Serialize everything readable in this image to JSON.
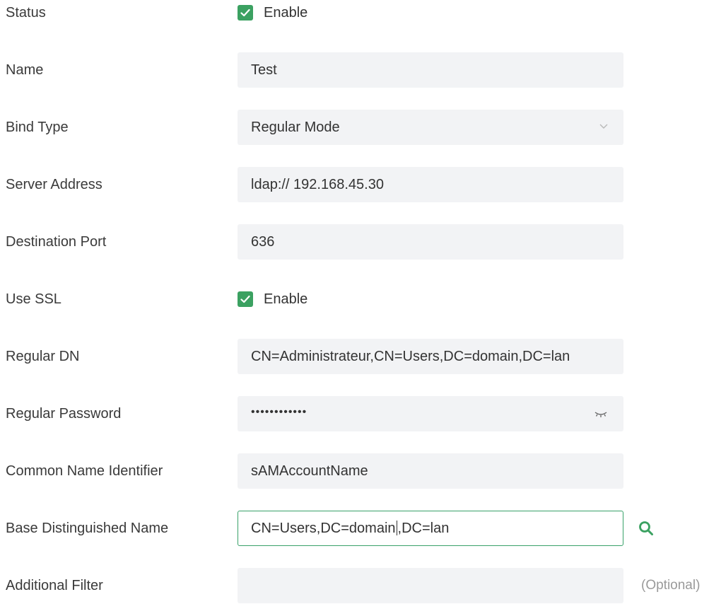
{
  "form": {
    "status": {
      "label": "Status",
      "checked": true,
      "option_label": "Enable"
    },
    "name": {
      "label": "Name",
      "value": "Test"
    },
    "bind_type": {
      "label": "Bind Type",
      "selected": "Regular Mode"
    },
    "server_address": {
      "label": "Server Address",
      "value": "ldap:// 192.168.45.30"
    },
    "destination_port": {
      "label": "Destination Port",
      "value": "636"
    },
    "use_ssl": {
      "label": "Use SSL",
      "checked": true,
      "option_label": "Enable"
    },
    "regular_dn": {
      "label": "Regular DN",
      "value": "CN=Administrateur,CN=Users,DC=domain,DC=lan"
    },
    "regular_password": {
      "label": "Regular Password",
      "value_masked": "••••••••••••"
    },
    "common_name_identifier": {
      "label": "Common Name Identifier",
      "value": "sAMAccountName"
    },
    "base_dn": {
      "label": "Base Distinguished Name",
      "value_before_cursor": "CN=Users,DC=domain",
      "value_after_cursor": ",DC=lan"
    },
    "additional_filter": {
      "label": "Additional Filter",
      "value": "",
      "hint": "(Optional)"
    }
  },
  "icons": {
    "checkbox": "check-icon",
    "dropdown": "chevron-down-icon",
    "password_toggle": "eye-closed-icon",
    "search": "search-icon"
  },
  "colors": {
    "accent": "#3ba161",
    "field_bg": "#f2f3f5",
    "focus_border": "#38a169",
    "hint": "#9a9a9a"
  }
}
